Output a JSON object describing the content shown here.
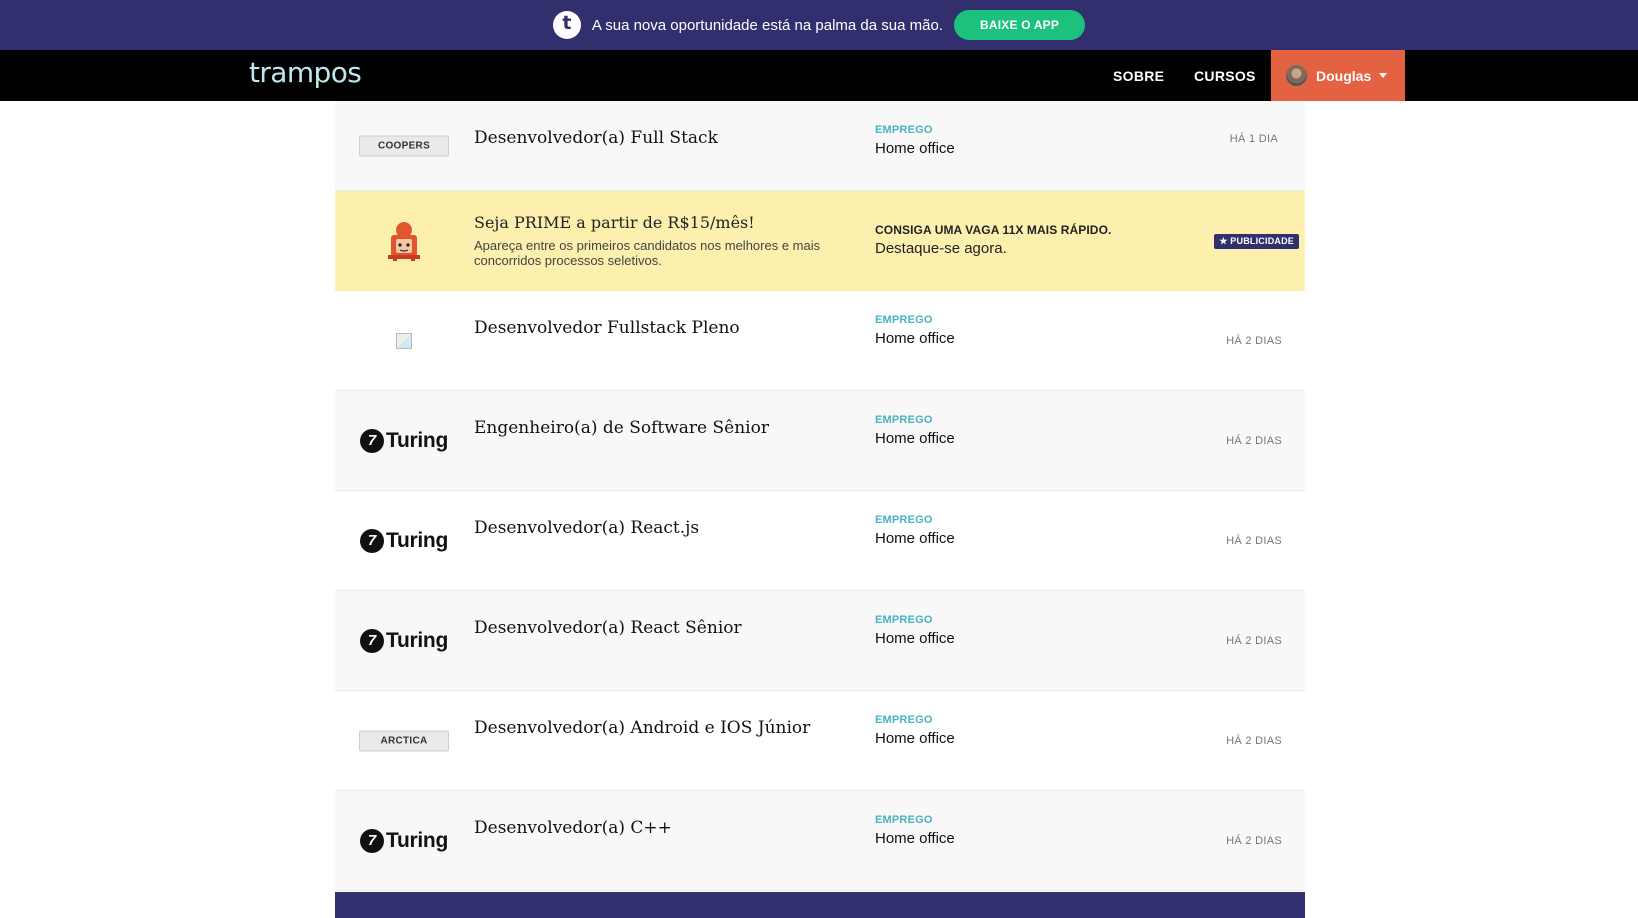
{
  "promo": {
    "logo_letter": "t",
    "text": "A sua nova oportunidade está na palma da sua mão.",
    "button_label": "BAIXE O APP"
  },
  "nav": {
    "brand": "trampos",
    "links": [
      "SOBRE",
      "CURSOS"
    ],
    "user_name": "Douglas"
  },
  "jobs": [
    {
      "company": "COOPERS",
      "logo_style": "tag",
      "title": "Desenvolvedor(a) Full Stack",
      "type": "EMPREGO",
      "location": "Home office",
      "posted": "HÁ 1 DIA"
    },
    {
      "company": "",
      "logo_style": "broken-image",
      "title": "Desenvolvedor Fullstack Pleno",
      "type": "EMPREGO",
      "location": "Home office",
      "posted": "HÁ 2 DIAS"
    },
    {
      "company": "Turing",
      "logo_style": "turing",
      "title": "Engenheiro(a) de Software Sênior",
      "type": "EMPREGO",
      "location": "Home office",
      "posted": "HÁ 2 DIAS"
    },
    {
      "company": "Turing",
      "logo_style": "turing",
      "title": "Desenvolvedor(a) React.js",
      "type": "EMPREGO",
      "location": "Home office",
      "posted": "HÁ 2 DIAS"
    },
    {
      "company": "Turing",
      "logo_style": "turing",
      "title": "Desenvolvedor(a) React Sênior",
      "type": "EMPREGO",
      "location": "Home office",
      "posted": "HÁ 2 DIAS"
    },
    {
      "company": "ARCTICA",
      "logo_style": "tag",
      "title": "Desenvolvedor(a) Android e IOS Júnior",
      "type": "EMPREGO",
      "location": "Home office",
      "posted": "HÁ 2 DIAS"
    },
    {
      "company": "Turing",
      "logo_style": "turing",
      "title": "Desenvolvedor(a) C++",
      "type": "EMPREGO",
      "location": "Home office",
      "posted": "HÁ 2 DIAS"
    }
  ],
  "ad": {
    "title": "Seja PRIME a partir de R$15/mês!",
    "description": "Apareça entre os primeiros candidatos nos melhores e mais concorridos processos seletivos.",
    "cta_heading": "CONSIGA UMA VAGA 11X MAIS RÁPIDO.",
    "cta_text": "Destaque-se agora.",
    "badge": "★ PUBLICIDADE"
  },
  "colors": {
    "promo_bg": "#312f6e",
    "app_button": "#1cc17d",
    "user_menu": "#e46142",
    "job_type": "#4ab2c0",
    "ad_bg": "#fdefae"
  }
}
